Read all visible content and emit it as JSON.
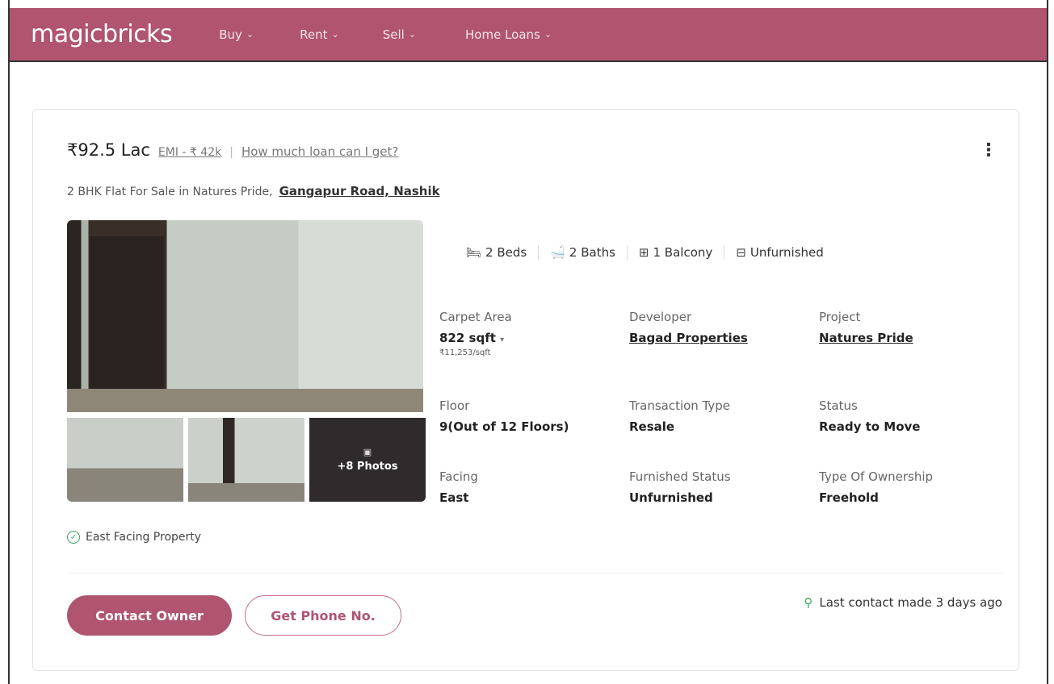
{
  "header": {
    "logo": "magicbricks",
    "nav": [
      {
        "label": "Buy"
      },
      {
        "label": "Rent"
      },
      {
        "label": "Sell"
      },
      {
        "label": "Home Loans"
      }
    ],
    "brand_color": "#b05470"
  },
  "listing": {
    "price": "₹92.5 Lac",
    "emi": "EMI - ₹ 42k",
    "separator": "|",
    "loan_link": "How much loan can I get?",
    "title": "2 BHK Flat For Sale in Natures Pride,",
    "location": "Gangapur Road, Nashik",
    "photos_more": "+8 Photos",
    "amenities": [
      {
        "label": "2 Beds",
        "icon": "bed-icon"
      },
      {
        "label": "2 Baths",
        "icon": "bath-icon"
      },
      {
        "label": "1 Balcony",
        "icon": "balcony-icon"
      },
      {
        "label": "Unfurnished",
        "icon": "furnishing-icon"
      }
    ],
    "details": {
      "carpet_area": {
        "label": "Carpet Area",
        "value": "822 sqft",
        "per_sqft": "₹11,253/sqft"
      },
      "developer": {
        "label": "Developer",
        "value": "Bagad Properties"
      },
      "project": {
        "label": "Project",
        "value": "Natures Pride"
      },
      "floor": {
        "label": "Floor",
        "value": "9(Out of 12 Floors)"
      },
      "transaction": {
        "label": "Transaction Type",
        "value": "Resale"
      },
      "status": {
        "label": "Status",
        "value": "Ready to Move"
      },
      "facing": {
        "label": "Facing",
        "value": "East"
      },
      "furnished": {
        "label": "Furnished Status",
        "value": "Unfurnished"
      },
      "ownership": {
        "label": "Type Of Ownership",
        "value": "Freehold"
      }
    },
    "feature": "East Facing Property",
    "contact_owner": "Contact Owner",
    "get_phone": "Get Phone No.",
    "last_contact": "Last contact made 3 days ago"
  }
}
